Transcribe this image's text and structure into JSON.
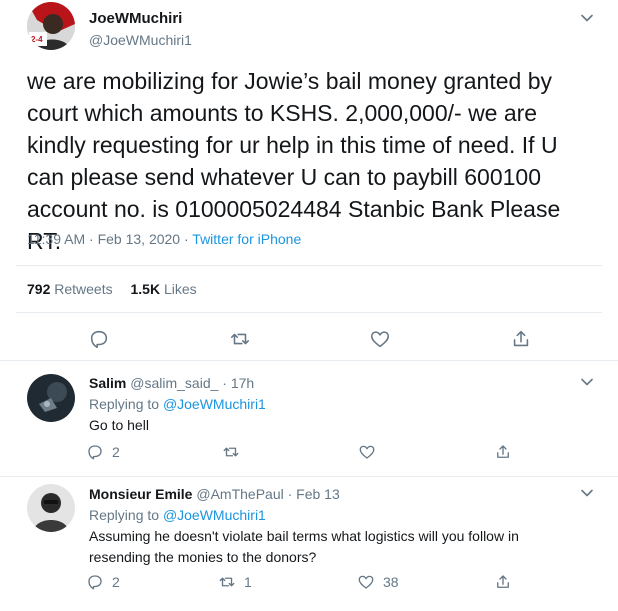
{
  "main_tweet": {
    "author_name": "JoeWMuchiri",
    "author_handle": "@JoeWMuchiri1",
    "avatar_badge": "2-4",
    "text": "we are mobilizing for Jowie’s bail money granted by court which amounts to KSHS. 2,000,000/-  we are kindly requesting for ur help in this time of need. If U can please send whatever U can to paybill 600100 account no. is 0100005024484 Stanbic Bank Please RT.",
    "time": "11:39 AM",
    "date": "Feb 13, 2020",
    "source": "Twitter for iPhone",
    "retweets_count": "792",
    "retweets_label": "Retweets",
    "likes_count": "1.5K",
    "likes_label": "Likes"
  },
  "replies": [
    {
      "name": "Salim",
      "handle": "@salim_said_",
      "time": "17h",
      "replying_label": "Replying to",
      "replying_to": "@JoeWMuchiri1",
      "text": "Go to hell",
      "reply_count": "2",
      "retweet_count": "",
      "like_count": ""
    },
    {
      "name": "Monsieur Emile",
      "handle": "@AmThePaul",
      "time": "Feb 13",
      "replying_label": "Replying to",
      "replying_to": "@JoeWMuchiri1",
      "text": "Assuming he doesn't violate bail terms what logistics will you follow in resending the monies to the donors?",
      "reply_count": "2",
      "retweet_count": "1",
      "like_count": "38"
    }
  ],
  "icons": {
    "caret": "chevron-down-icon",
    "reply": "comment-icon",
    "retweet": "retweet-icon",
    "like": "heart-icon",
    "share": "share-icon"
  },
  "colors": {
    "link": "#1b95e0",
    "muted": "#657786",
    "text": "#14171a",
    "border": "#e6ecf0"
  }
}
